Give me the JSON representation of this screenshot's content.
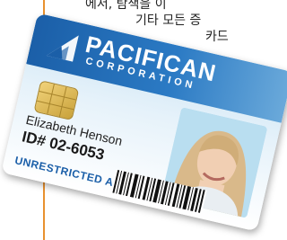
{
  "background_text": {
    "line1": "에서, 탐색을 이",
    "line2": "기타 모든 증",
    "line3": "카드"
  },
  "card": {
    "brand_name": "PACIFICAN",
    "brand_sub": "CORPORATION",
    "holder_name": "Elizabeth Henson",
    "holder_id": "ID# 02-6053",
    "access_label": "UNRESTRICTED ACCESS"
  },
  "colors": {
    "accent_rule": "#e8912f",
    "brand_blue": "#1b5fa8"
  }
}
